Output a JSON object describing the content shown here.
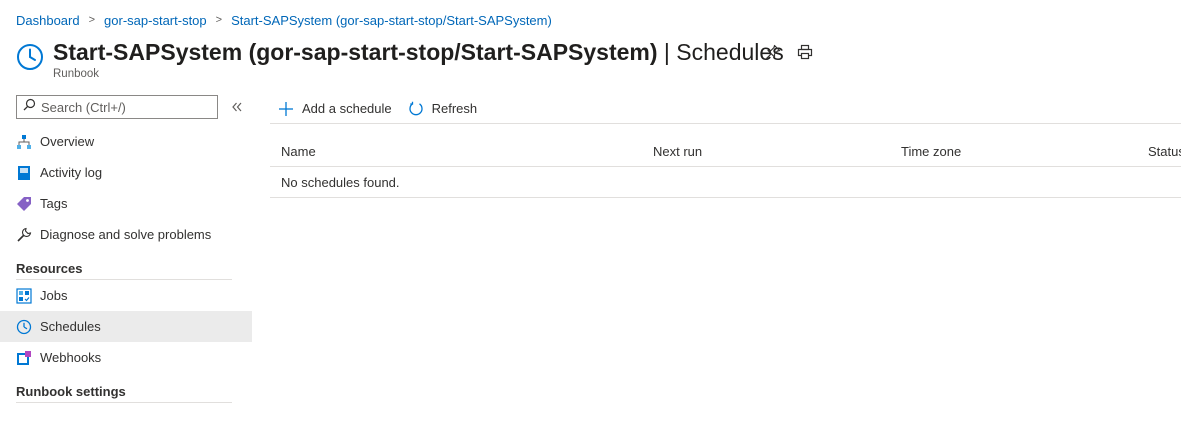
{
  "breadcrumb": [
    "Dashboard",
    "gor-sap-start-stop",
    "Start-SAPSystem (gor-sap-start-stop/Start-SAPSystem)"
  ],
  "header": {
    "title_main": "Start-SAPSystem (gor-sap-start-stop/Start-SAPSystem)",
    "title_divider": " | ",
    "title_section": "Schedules",
    "subtitle": "Runbook",
    "icon": "clock-icon",
    "actions": [
      "pin-icon",
      "print-icon"
    ]
  },
  "sidebar": {
    "search_placeholder": "Search (Ctrl+/)",
    "items": [
      {
        "label": "Overview",
        "icon": "overview-icon"
      },
      {
        "label": "Activity log",
        "icon": "activity-log-icon"
      },
      {
        "label": "Tags",
        "icon": "tag-icon"
      },
      {
        "label": "Diagnose and solve problems",
        "icon": "wrench-icon"
      }
    ],
    "section_resources": "Resources",
    "resources": [
      {
        "label": "Jobs",
        "icon": "jobs-icon"
      },
      {
        "label": "Schedules",
        "icon": "clock-icon",
        "selected": true
      },
      {
        "label": "Webhooks",
        "icon": "webhook-icon"
      }
    ],
    "section_settings": "Runbook settings"
  },
  "toolbar": {
    "add_label": "Add a schedule",
    "refresh_label": "Refresh"
  },
  "grid": {
    "columns": [
      "Name",
      "Next run",
      "Time zone",
      "Status"
    ],
    "empty_text": "No schedules found."
  },
  "colors": {
    "link": "#0067b8",
    "accent": "#0078d4",
    "selected_bg": "#ebebeb",
    "border": "#e1dfdd"
  }
}
